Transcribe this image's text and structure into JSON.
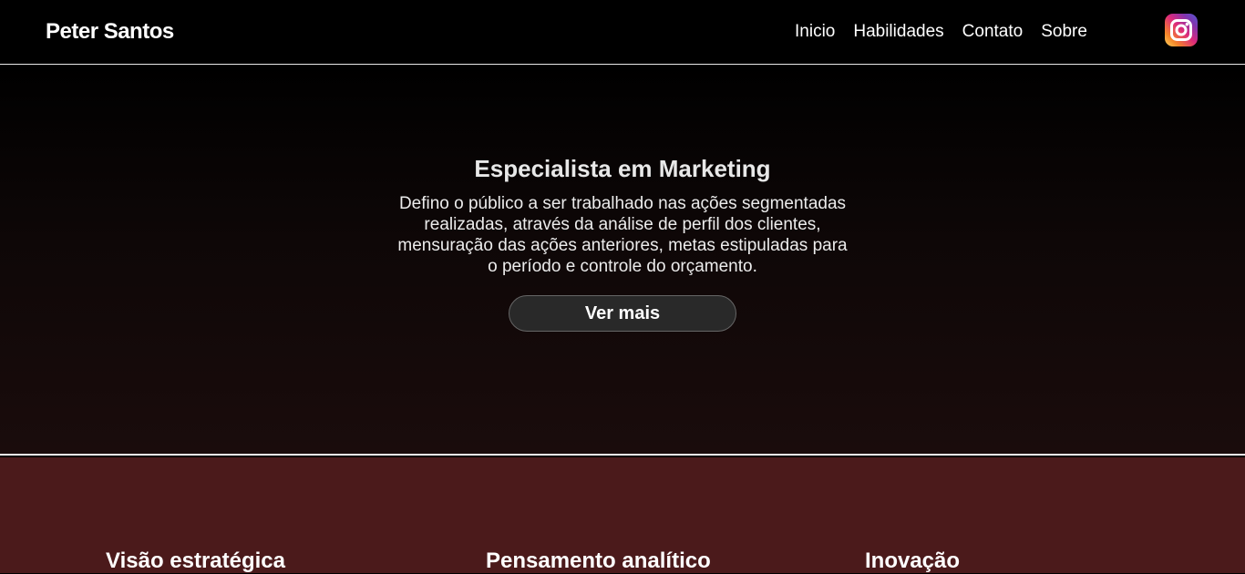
{
  "header": {
    "brand": "Peter Santos",
    "nav": [
      "Inicio",
      "Habilidades",
      "Contato",
      "Sobre"
    ],
    "social_icon": "instagram-icon"
  },
  "hero": {
    "title": "Especialista em Marketing",
    "text": "Defino o público a ser trabalhado nas ações segmentadas realizadas, através da análise de perfil dos clientes, mensuração das ações anteriores, metas estipuladas para o período e controle do orçamento.",
    "button_label": "Ver mais"
  },
  "skills": [
    {
      "title": "Visão estratégica"
    },
    {
      "title": "Pensamento analítico"
    },
    {
      "title": "Inovação"
    }
  ],
  "colors": {
    "header_background": "#000000",
    "hero_background": "#000000",
    "skills_background": "#4b1a1b",
    "button_background": "#292929"
  }
}
